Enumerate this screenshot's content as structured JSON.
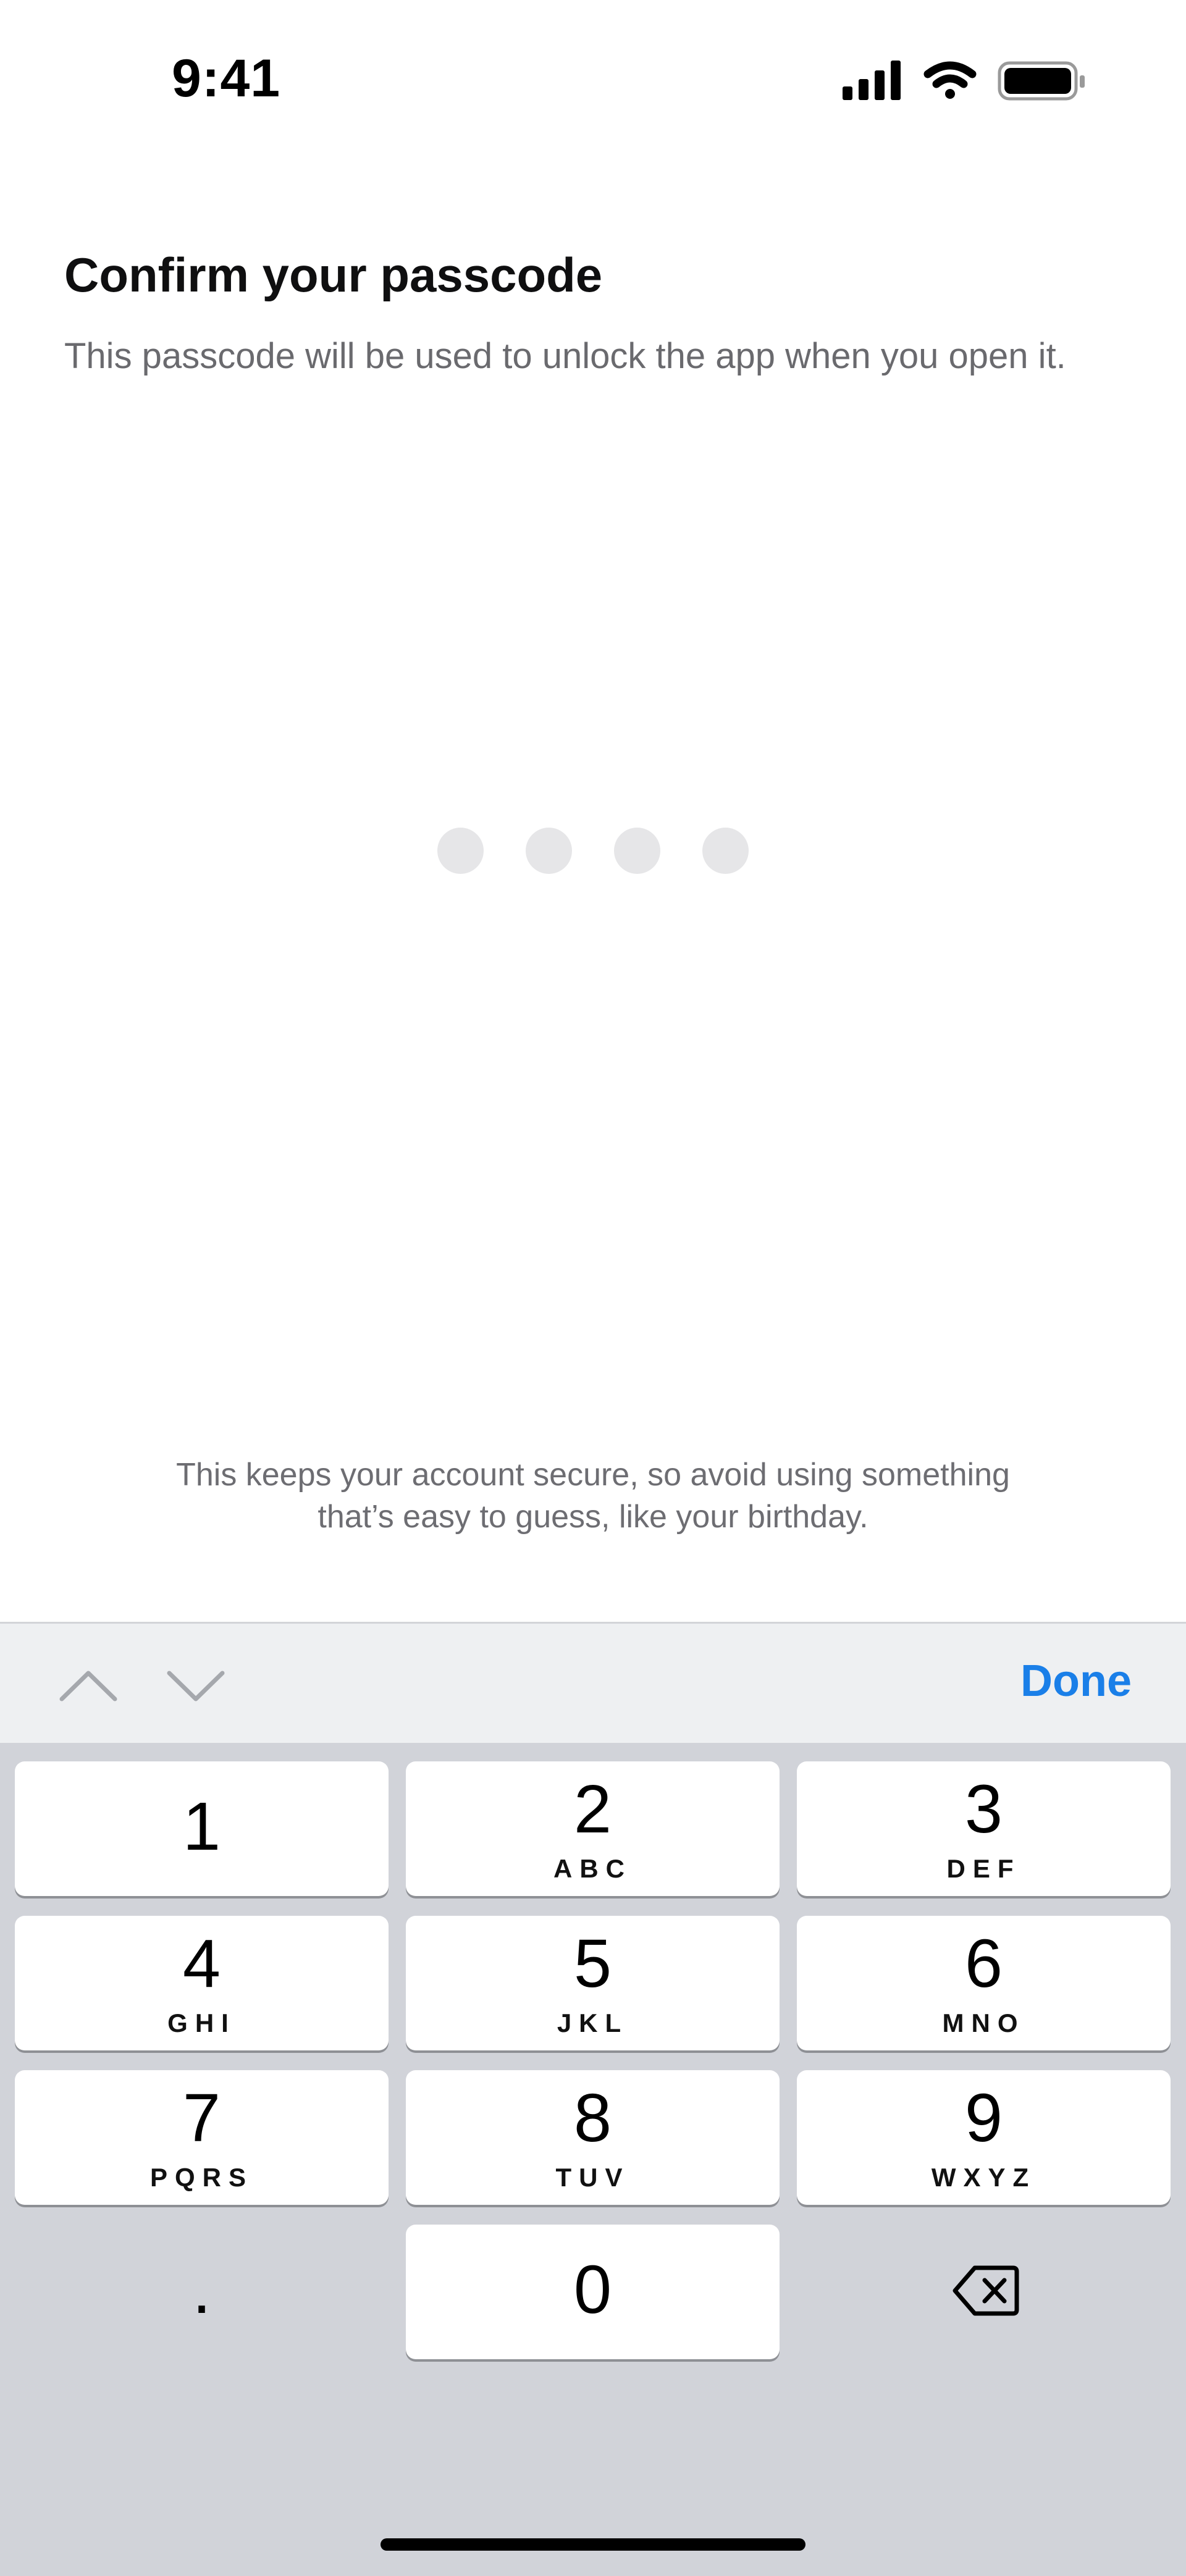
{
  "status_bar": {
    "time": "9:41",
    "icons": [
      "cellular-signal-icon",
      "wifi-icon",
      "battery-icon"
    ]
  },
  "header": {
    "title": "Confirm your passcode",
    "subtitle": "This passcode will be used to unlock the app when you open it."
  },
  "passcode": {
    "digits_entered": 0,
    "length": 4
  },
  "hint": {
    "line1": "This keeps your account secure, so avoid using something",
    "line2": "that’s easy to guess, like your birthday."
  },
  "accessory_bar": {
    "prev_icon": "chevron-up-icon",
    "next_icon": "chevron-down-icon",
    "done_label": "Done",
    "done_color": "#1a7fe8"
  },
  "keypad": {
    "keys": [
      {
        "digit": "1",
        "letters": ""
      },
      {
        "digit": "2",
        "letters": "ABC"
      },
      {
        "digit": "3",
        "letters": "DEF"
      },
      {
        "digit": "4",
        "letters": "GHI"
      },
      {
        "digit": "5",
        "letters": "JKL"
      },
      {
        "digit": "6",
        "letters": "MNO"
      },
      {
        "digit": "7",
        "letters": "PQRS"
      },
      {
        "digit": "8",
        "letters": "TUV"
      },
      {
        "digit": "9",
        "letters": "WXYZ"
      },
      {
        "digit": "0",
        "letters": ""
      }
    ],
    "decimal_label": ".",
    "backspace_icon": "backspace-icon"
  }
}
